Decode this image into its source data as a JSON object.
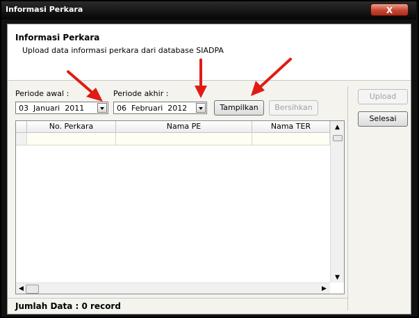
{
  "window": {
    "title": "Informasi Perkara",
    "close_glyph": "X"
  },
  "header": {
    "title": "Informasi Perkara",
    "subtitle": "Upload data informasi perkara dari database SIADPA"
  },
  "filters": {
    "start_label": "Periode awal :",
    "start_value": "03  Januari  2011",
    "end_label": "Periode akhir :",
    "end_value": "06  Februari  2012"
  },
  "buttons": {
    "tampilkan": "Tampilkan",
    "bersihkan": "Bersihkan",
    "upload": "Upload",
    "selesai": "Selesai"
  },
  "grid": {
    "columns": [
      "No. Perkara",
      "Nama PE",
      "Nama TER"
    ]
  },
  "status": {
    "text": "Jumlah Data : 0 record"
  },
  "colors": {
    "annotation_arrow": "#e01b14",
    "title_bar": "#0b0b0b",
    "client_bg": "#f4f3ee"
  }
}
